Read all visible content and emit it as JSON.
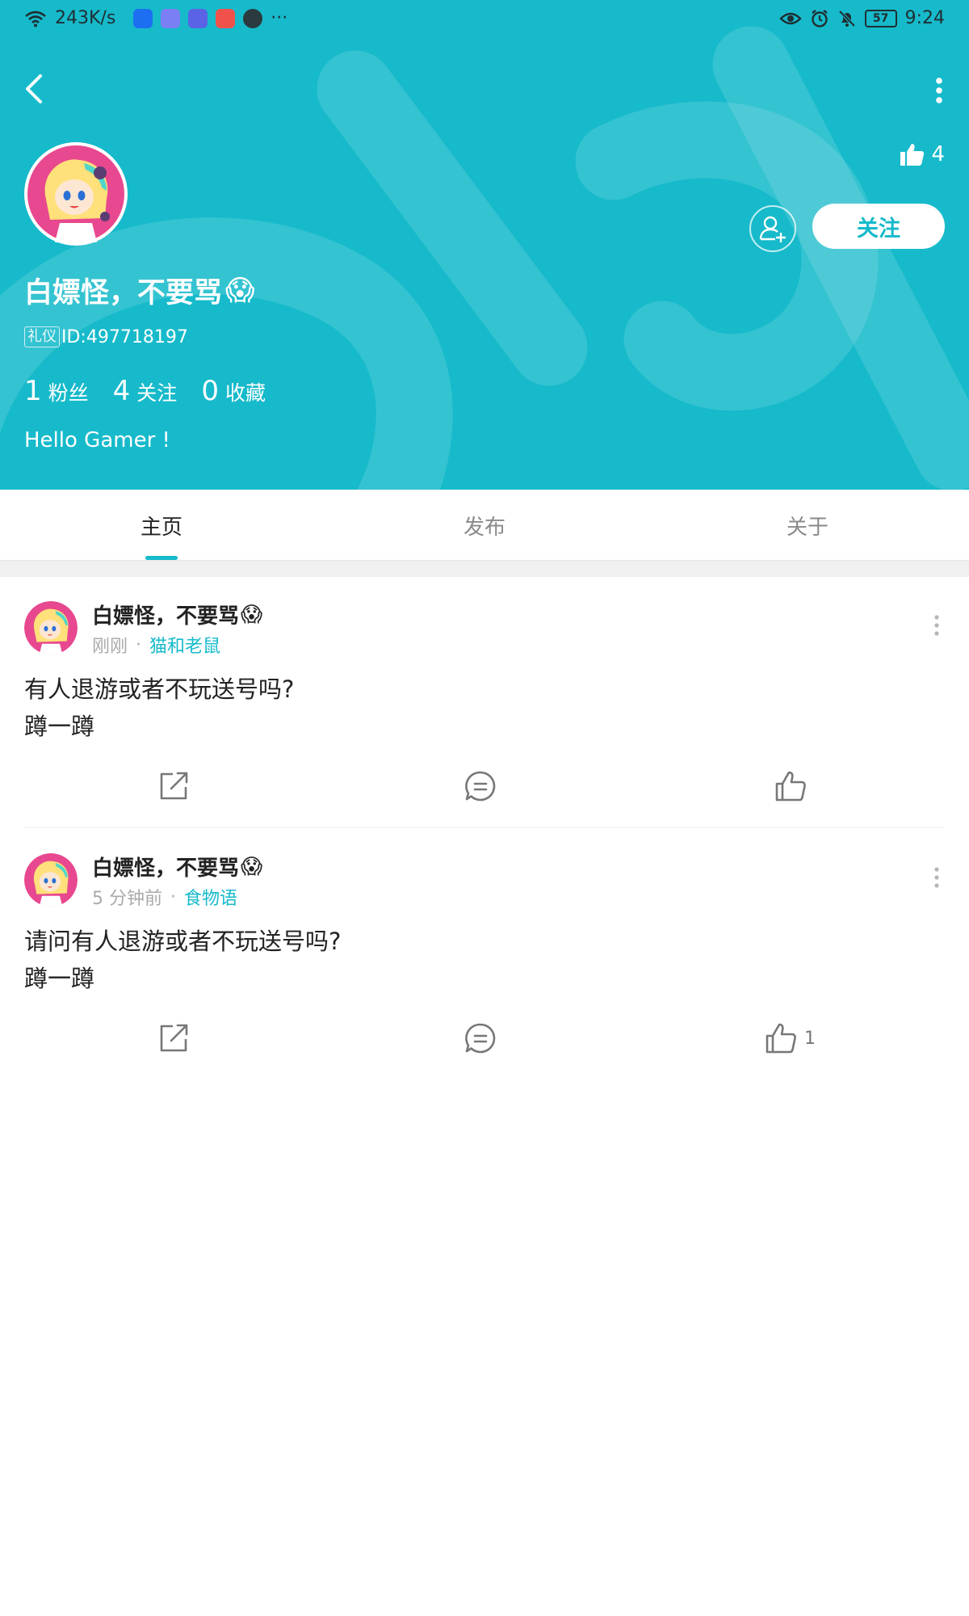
{
  "status_bar": {
    "speed": "243K/s",
    "time": "9:24",
    "battery": "57",
    "more_dots": "···"
  },
  "header": {
    "likes_count": "4",
    "follow_label": "关注",
    "username": "白嫖怪，不要骂",
    "username_emoji": "😱",
    "badge_label": "礼仪",
    "user_id": "ID:497718197",
    "stats": [
      {
        "num": "1",
        "label": "粉丝"
      },
      {
        "num": "4",
        "label": "关注"
      },
      {
        "num": "0",
        "label": "收藏"
      }
    ],
    "bio": "Hello Gamer !",
    "accent_color": "#16bacb"
  },
  "tabs": [
    {
      "label": "主页",
      "active": true
    },
    {
      "label": "发布",
      "active": false
    },
    {
      "label": "关于",
      "active": false
    }
  ],
  "posts": [
    {
      "author": "白嫖怪，不要骂",
      "emoji": "😱",
      "time": "刚刚",
      "sep": "·",
      "tag": "猫和老鼠",
      "line1": "有人退游或者不玩送号吗?",
      "line2": "蹲一蹲",
      "like_count": ""
    },
    {
      "author": "白嫖怪，不要骂",
      "emoji": "😱",
      "time": "5 分钟前",
      "sep": "·",
      "tag": "食物语",
      "line1": "请问有人退游或者不玩送号吗?",
      "line2": "蹲一蹲",
      "like_count": "1"
    }
  ]
}
